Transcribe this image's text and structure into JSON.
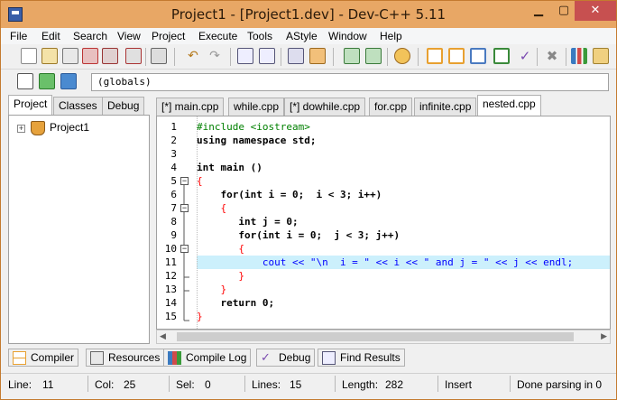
{
  "window": {
    "title": "Project1 - [Project1.dev] - Dev-C++ 5.11"
  },
  "menu": [
    "File",
    "Edit",
    "Search",
    "View",
    "Project",
    "Execute",
    "Tools",
    "AStyle",
    "Window",
    "Help"
  ],
  "scope": {
    "value": "(globals)"
  },
  "left_tabs": [
    "Project",
    "Classes",
    "Debug"
  ],
  "project_tree": {
    "root": "Project1"
  },
  "editor_tabs": [
    "[*] main.cpp",
    "while.cpp",
    "[*] dowhile.cpp",
    "for.cpp",
    "infinite.cpp",
    "nested.cpp"
  ],
  "code_lines": [
    "#include <iostream>",
    "using namespace std;",
    "",
    "int main ()",
    "{",
    "    for(int i = 0;  i < 3; i++)",
    "    {",
    "       int j = 0;",
    "       for(int i = 0;  j < 3; j++)",
    "       {",
    "           cout << \"\\n  i = \" << i << \" and j = \" << j << endl;",
    "       }",
    "    }",
    "    return 0;",
    "}"
  ],
  "line_numbers": [
    "1",
    "2",
    "3",
    "4",
    "5",
    "6",
    "7",
    "8",
    "9",
    "10",
    "11",
    "12",
    "13",
    "14",
    "15"
  ],
  "bottom_tabs": [
    "Compiler",
    "Resources",
    "Compile Log",
    "Debug",
    "Find Results"
  ],
  "status": {
    "line_label": "Line:",
    "line_value": "11",
    "col_label": "Col:",
    "col_value": "25",
    "sel_label": "Sel:",
    "sel_value": "0",
    "lines_label": "Lines:",
    "lines_value": "15",
    "length_label": "Length:",
    "length_value": "282",
    "mode": "Insert",
    "message": "Done parsing in 0"
  },
  "colors": {
    "titlebar": "#e8a765",
    "current_line": "#ccf0fc",
    "close": "#c75050"
  }
}
